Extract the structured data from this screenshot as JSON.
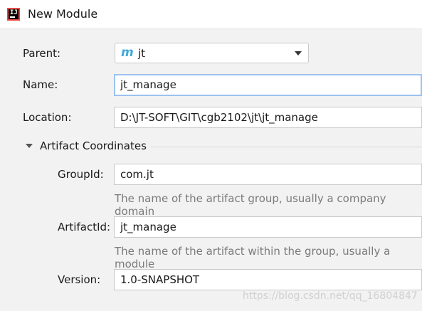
{
  "window": {
    "title": "New Module",
    "icon": "intellij-app-icon"
  },
  "form": {
    "parent_label": "Parent:",
    "parent_value": "jt",
    "parent_icon": "maven-module-icon",
    "name_label": "Name:",
    "name_value": "jt_manage",
    "location_label": "Location:",
    "location_value": "D:\\JT-SOFT\\GIT\\cgb2102\\jt\\jt_manage"
  },
  "artifact": {
    "section_title": "Artifact Coordinates",
    "groupid_label": "GroupId:",
    "groupid_value": "com.jt",
    "groupid_hint": "The name of the artifact group, usually a company domain",
    "artifactid_label": "ArtifactId:",
    "artifactid_value": "jt_manage",
    "artifactid_hint": "The name of the artifact within the group, usually a module",
    "version_label": "Version:",
    "version_value": "1.0-SNAPSHOT"
  },
  "watermark": "https://blog.csdn.net/qq_16804847",
  "colors": {
    "focus_border": "#9cc2ef",
    "maven_icon": "#3fa9d8",
    "hint_text": "#7a7a7a"
  }
}
